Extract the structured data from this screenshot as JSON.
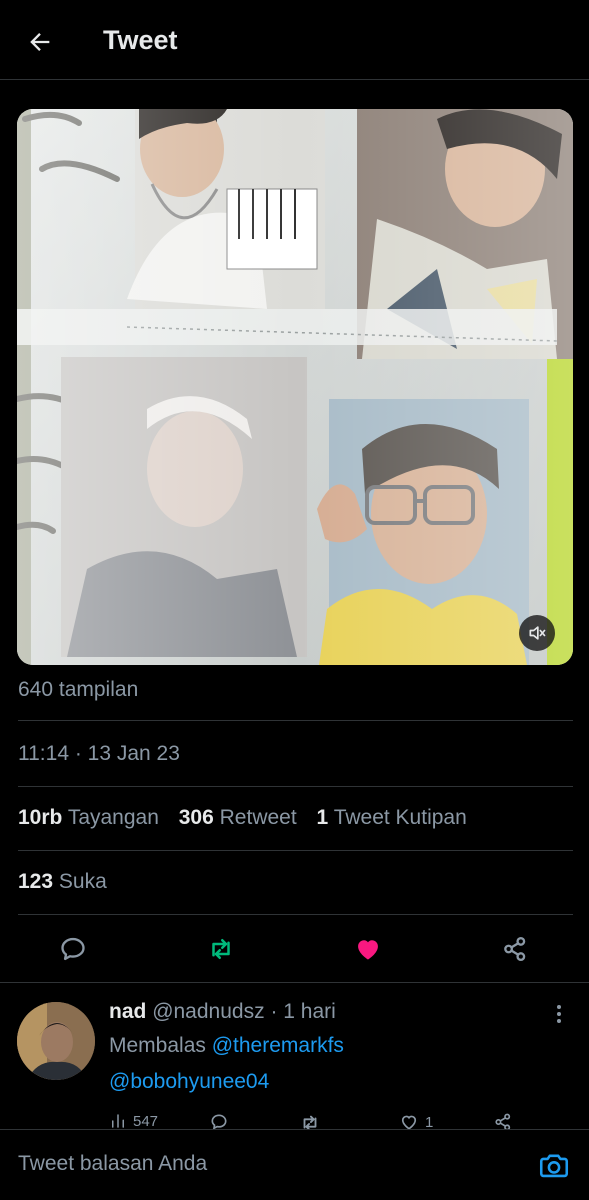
{
  "header": {
    "title": "Tweet",
    "back_icon": "arrow-left-icon"
  },
  "media": {
    "mute_icon": "volume-muted-icon"
  },
  "tweet": {
    "views": "640 tampilan",
    "timestamp": "11:14 · 13 Jan 23",
    "stats": [
      {
        "num": "10rb",
        "label": "Tayangan"
      },
      {
        "num": "306",
        "label": "Retweet"
      },
      {
        "num": "1",
        "label": "Tweet Kutipan"
      }
    ],
    "likes": {
      "num": "123",
      "label": "Suka"
    }
  },
  "actions": {
    "reply_icon": "comment-icon",
    "retweet_icon": "retweet-icon",
    "like_icon": "heart-icon",
    "share_icon": "share-icon",
    "colors": {
      "retweet": "#00ba7c",
      "like": "#f91880",
      "default": "#8b98a5"
    }
  },
  "reply": {
    "name": "nad",
    "handle": "@nadnudsz",
    "separator": "·",
    "time": "1 hari",
    "replying_prefix": "Membalas",
    "mention1": "@theremarkfs",
    "mention2": "@bobohyunee04",
    "views_count": "547",
    "likes_count": "1"
  },
  "compose": {
    "placeholder": "Tweet balasan Anda",
    "camera_icon": "camera-icon"
  },
  "colors": {
    "background": "#000000",
    "text": "#e7e9ea",
    "muted": "#8b98a5",
    "accent": "#1d9bf0",
    "border": "#2f3336"
  }
}
